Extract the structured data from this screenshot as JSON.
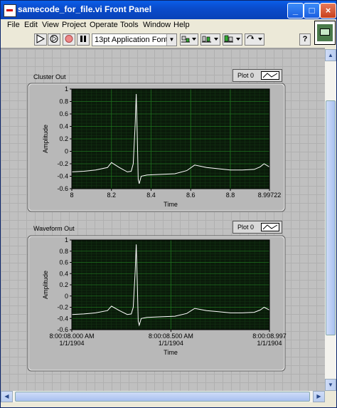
{
  "window": {
    "title": "samecode_for_file.vi Front Panel",
    "buttons": {
      "minimize": "_",
      "maximize": "□",
      "close": "×"
    }
  },
  "menu": {
    "items": [
      "File",
      "Edit",
      "View",
      "Project",
      "Operate",
      "Tools",
      "Window",
      "Help"
    ]
  },
  "toolbar": {
    "font": "13pt Application Font",
    "icons": [
      "run-arrow-icon",
      "run-continuous-icon",
      "abort-icon",
      "pause-icon",
      "align-icon",
      "distribute-icon",
      "resize-icon",
      "reorder-icon",
      "help-icon"
    ]
  },
  "graphs": [
    {
      "name": "Cluster Out",
      "legend": "Plot 0",
      "ylabel": "Amplitude",
      "xlabel": "Time",
      "yticks": [
        "1",
        "0.8",
        "0.6",
        "0.4",
        "0.2",
        "0",
        "-0.2",
        "-0.4",
        "-0.6"
      ],
      "xticks": [
        "8",
        "8.2",
        "8.4",
        "8.6",
        "8.8",
        "8.99722"
      ],
      "xticks2": [
        "",
        "",
        "",
        "",
        "",
        ""
      ]
    },
    {
      "name": "Waveform Out",
      "legend": "Plot 0",
      "ylabel": "Amplitude",
      "xlabel": "Time",
      "yticks": [
        "1",
        "0.8",
        "0.6",
        "0.4",
        "0.2",
        "0",
        "-0.2",
        "-0.4",
        "-0.6"
      ],
      "xticks": [
        "8:00:08.000 AM",
        "8:00:08.500 AM",
        "8:00:08.997"
      ],
      "xticks2": [
        "1/1/1904",
        "1/1/1904",
        "1/1/1904"
      ]
    }
  ],
  "chart_data": [
    {
      "type": "line",
      "x": [
        8.0,
        8.06,
        8.12,
        8.18,
        8.2,
        8.24,
        8.28,
        8.3,
        8.31,
        8.32,
        8.325,
        8.33,
        8.335,
        8.34,
        8.35,
        8.38,
        8.45,
        8.52,
        8.58,
        8.62,
        8.68,
        8.74,
        8.8,
        8.86,
        8.92,
        8.95,
        8.97,
        8.99722
      ],
      "y": [
        -0.33,
        -0.32,
        -0.3,
        -0.26,
        -0.18,
        -0.26,
        -0.33,
        -0.32,
        -0.2,
        0.45,
        0.92,
        0.3,
        -0.45,
        -0.52,
        -0.4,
        -0.38,
        -0.37,
        -0.36,
        -0.31,
        -0.22,
        -0.26,
        -0.28,
        -0.3,
        -0.3,
        -0.29,
        -0.25,
        -0.2,
        -0.25
      ],
      "ylim": [
        -0.6,
        1
      ],
      "xlim": [
        8.0,
        8.99722
      ],
      "xlabel": "Time",
      "ylabel": "Amplitude",
      "series": [
        {
          "name": "Plot 0"
        }
      ]
    },
    {
      "type": "line",
      "x": [
        0.0,
        0.06,
        0.12,
        0.18,
        0.2,
        0.24,
        0.28,
        0.3,
        0.31,
        0.32,
        0.325,
        0.33,
        0.335,
        0.34,
        0.35,
        0.38,
        0.45,
        0.52,
        0.58,
        0.62,
        0.68,
        0.74,
        0.8,
        0.86,
        0.92,
        0.95,
        0.97,
        0.997
      ],
      "y": [
        -0.33,
        -0.32,
        -0.3,
        -0.26,
        -0.18,
        -0.26,
        -0.33,
        -0.32,
        -0.2,
        0.45,
        0.92,
        0.3,
        -0.45,
        -0.52,
        -0.4,
        -0.38,
        -0.37,
        -0.36,
        -0.31,
        -0.22,
        -0.26,
        -0.28,
        -0.3,
        -0.3,
        -0.29,
        -0.25,
        -0.2,
        -0.25
      ],
      "ylim": [
        -0.6,
        1
      ],
      "xlim": [
        0.0,
        0.997
      ],
      "xlabel": "Time",
      "ylabel": "Amplitude",
      "series": [
        {
          "name": "Plot 0"
        }
      ]
    }
  ],
  "colors": {
    "plot_bg": "#0a1a0a",
    "grid": "#1e6e1e",
    "trace": "#ffffff",
    "panel": "#c0c0c0"
  }
}
